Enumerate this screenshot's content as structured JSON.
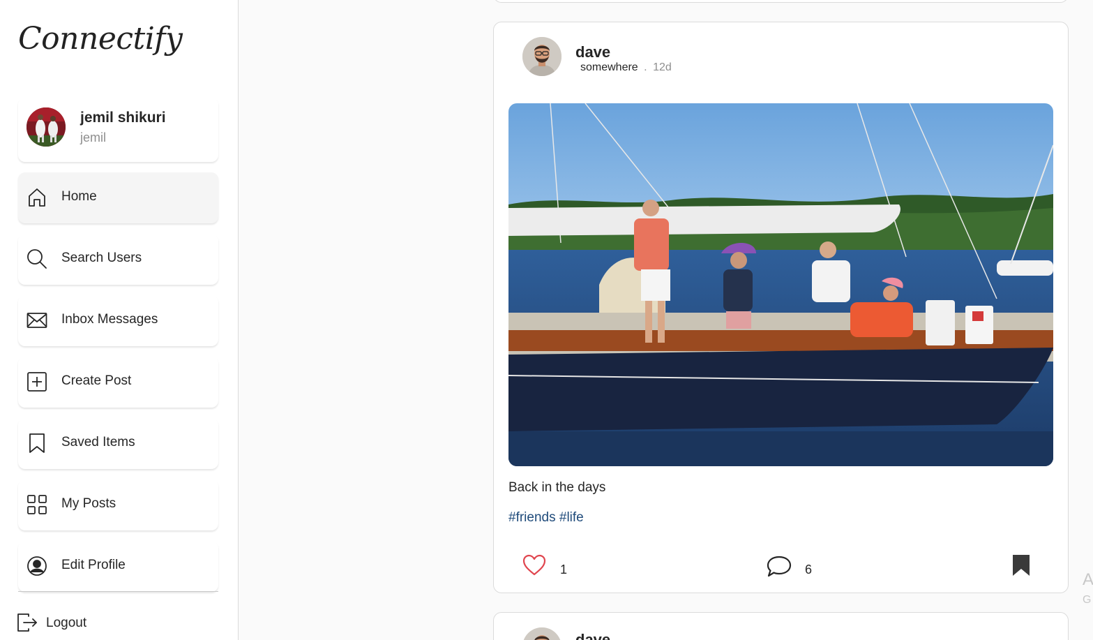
{
  "app": {
    "logo": "Connectify"
  },
  "profile": {
    "name": "jemil shikuri",
    "handle": "jemil"
  },
  "nav": {
    "items": [
      {
        "label": "Home",
        "icon": "home-icon"
      },
      {
        "label": "Search Users",
        "icon": "search-icon"
      },
      {
        "label": "Inbox Messages",
        "icon": "mail-icon"
      },
      {
        "label": "Create Post",
        "icon": "plus-square-icon"
      },
      {
        "label": "Saved Items",
        "icon": "bookmark-icon"
      },
      {
        "label": "My Posts",
        "icon": "grid-icon"
      },
      {
        "label": "Edit Profile",
        "icon": "user-circle-icon"
      }
    ],
    "logout_label": "Logout",
    "active": "Home"
  },
  "post": {
    "author": "dave",
    "location": "somewhere",
    "separator": ".",
    "age": "12d",
    "caption": "Back in the days",
    "tags": [
      "#friends",
      "#life"
    ],
    "likes": "1",
    "comments": "6",
    "saved": true
  },
  "next_post": {
    "author": "dave"
  },
  "edge": {
    "letter_a": "A",
    "letter_g": "G"
  },
  "colors": {
    "like": "#e0454e",
    "tag": "#1e4a7a",
    "border": "#dbdbdb"
  }
}
